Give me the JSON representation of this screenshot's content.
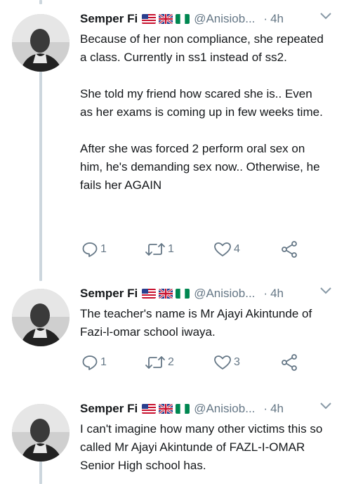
{
  "tweets": [
    {
      "name": "Semper Fi",
      "handle": "@Anisiob...",
      "time": "4h",
      "text": [
        "Because of her non compliance, she repeated a class. Currently in ss1 instead of ss2.",
        "She told my friend how scared she is.. Even as her exams is coming up in few weeks time.",
        "After she was forced 2 perform oral sex on him, he's demanding sex now.. Otherwise, he fails her AGAIN"
      ],
      "replies": "1",
      "retweets": "1",
      "likes": "4"
    },
    {
      "name": "Semper Fi",
      "handle": "@Anisiob...",
      "time": "4h",
      "text": [
        "The teacher's name is Mr Ajayi Akintunde of Fazi-l-omar school iwaya."
      ],
      "replies": "1",
      "retweets": "2",
      "likes": "3"
    },
    {
      "name": "Semper Fi",
      "handle": "@Anisiob...",
      "time": "4h",
      "text": [
        "I can't imagine how many other victims this so called Mr Ajayi Akintunde of FAZL-I-OMAR Senior High school has."
      ]
    }
  ],
  "dot": "·",
  "colors": {
    "secondary": "#657786",
    "thread": "#ccd6dd",
    "text": "#14171a"
  },
  "icons": [
    "avatar-photo",
    "us-flag-icon",
    "uk-flag-icon",
    "nigeria-flag-icon",
    "caret-down-icon",
    "reply-icon",
    "retweet-icon",
    "like-icon",
    "share-icon"
  ]
}
